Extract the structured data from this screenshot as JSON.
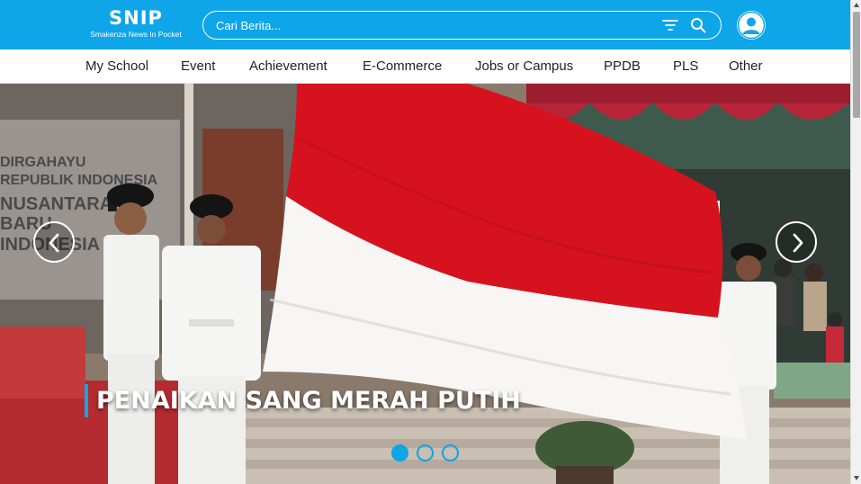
{
  "header": {
    "logo_title": "SNIP",
    "logo_subtitle": "Smakenza News In Pocket",
    "search_placeholder": "Cari Berita...",
    "filter_icon": "filter-icon",
    "search_icon": "search-icon",
    "profile_icon": "user-profile-icon",
    "brand_color": "#0ea5e9"
  },
  "nav": {
    "items": [
      "My School",
      "Event",
      "Achievement",
      "E-Commerce",
      "Jobs or Campus",
      "PPDB",
      "PLS",
      "Other"
    ]
  },
  "hero": {
    "caption": "PENAIKAN SANG MERAH PUTIH",
    "prev_icon": "chevron-left-icon",
    "next_icon": "chevron-right-icon",
    "slide_count": 3,
    "active_slide": 1,
    "background_text": [
      "DIRGAHAYU",
      "REPUBLIK INDONESIA",
      "NUSANTARA",
      "BARU",
      "INDONESIA"
    ]
  }
}
